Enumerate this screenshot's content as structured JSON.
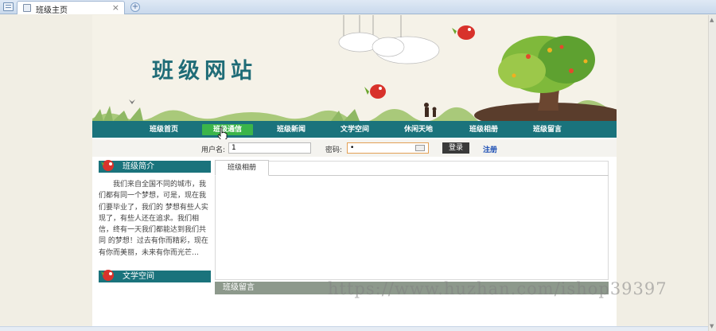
{
  "browser": {
    "tab_title": "班级主页",
    "tab_close": "×",
    "new_tab": "+"
  },
  "banner": {
    "site_title": "班级网站"
  },
  "nav": {
    "items": [
      "班级首页",
      "班级通信",
      "班级新闻",
      "文学空间",
      "休闲天地",
      "班级相册",
      "班级留言"
    ]
  },
  "login": {
    "username_label": "用户名:",
    "username_value": "1",
    "password_label": "密码:",
    "password_value": "•",
    "login_button": "登录",
    "register_link": "注册"
  },
  "sidebar": {
    "intro_title": "班级简介",
    "intro_text": "我们来自全国不同的城市，我们都有同一个梦想，可是，现在我们要毕业了，我们的 梦想有些人实现了，有些人还在追求。我们相信，终有一天我们都能达到我们共同 的梦想！过去有你而精彩，现在有你而美丽，未来有你而光芒…",
    "literature_title": "文学空间"
  },
  "main": {
    "album_tab": "班级相册",
    "message_title": "班级留言"
  },
  "watermark": "https://www.huzhan.com/ishop39397",
  "colors": {
    "nav_bg": "#1a737c",
    "nav_active": "#3bb54a",
    "message_bar": "#8d998c"
  }
}
